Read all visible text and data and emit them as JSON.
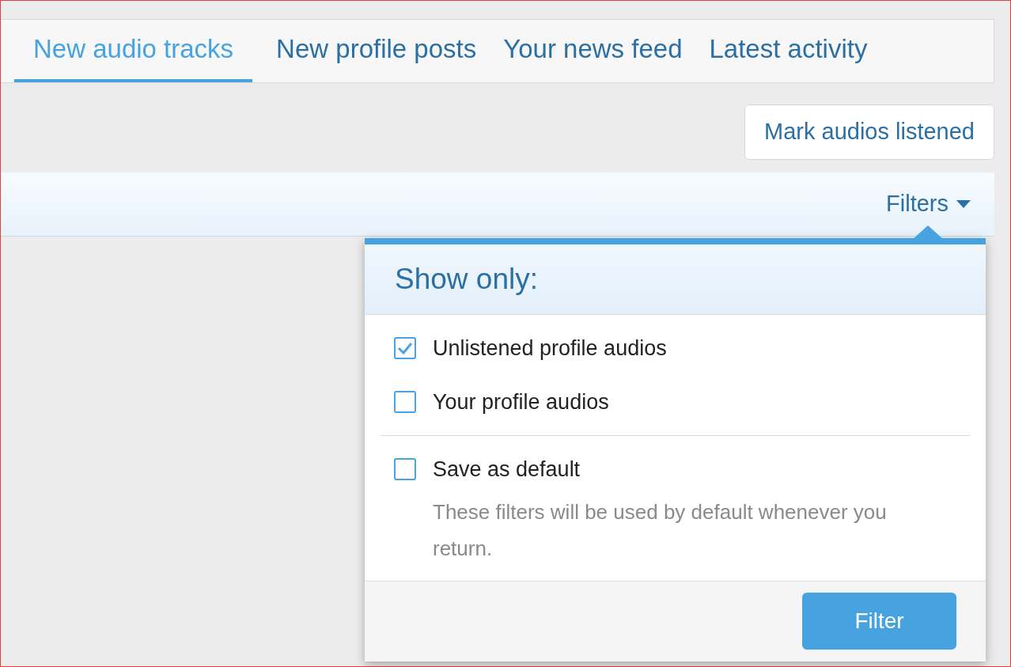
{
  "tabs": [
    {
      "label": "New audio tracks",
      "selected": true
    },
    {
      "label": "New profile posts",
      "selected": false
    },
    {
      "label": "Your news feed",
      "selected": false
    },
    {
      "label": "Latest activity",
      "selected": false
    }
  ],
  "action_button": "Mark audios listened",
  "filter_bar": {
    "label": "Filters",
    "expanded": true
  },
  "filter_menu": {
    "title": "Show only:",
    "options": [
      {
        "label": "Unlistened profile audios",
        "checked": true
      },
      {
        "label": "Your profile audios",
        "checked": false
      }
    ],
    "save_default": {
      "label": "Save as default",
      "checked": false,
      "hint": "These filters will be used by default whenever you return."
    },
    "submit": "Filter"
  }
}
